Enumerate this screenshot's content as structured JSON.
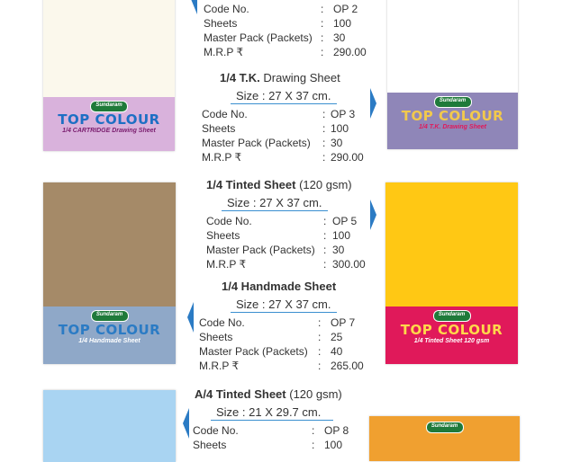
{
  "brand": "Sundaram",
  "logo_text": "TOP COLOUR",
  "products": [
    {
      "title_bold": "",
      "title_rest": "",
      "size": "",
      "specs": [
        {
          "label": "Code No.",
          "value": "OP 2"
        },
        {
          "label": "Sheets",
          "value": "100"
        },
        {
          "label": "Master Pack (Packets)",
          "value": "30"
        },
        {
          "label": "M.R.P ₹",
          "value": "290.00"
        }
      ],
      "pack_subtitle": "1/4 CARTRIDGE Drawing Sheet",
      "sheet_color": "#fbf8ec",
      "band_color": "#d9b2dc"
    },
    {
      "title_bold": "1/4 T.K.",
      "title_rest": " Drawing Sheet",
      "size": "Size : 27 X 37 cm.",
      "specs": [
        {
          "label": "Code No.",
          "value": "OP 3"
        },
        {
          "label": "Sheets",
          "value": "100"
        },
        {
          "label": "Master Pack (Packets)",
          "value": "30"
        },
        {
          "label": "M.R.P ₹",
          "value": "290.00"
        }
      ],
      "pack_subtitle": "1/4 T.K. Drawing Sheet",
      "sheet_color": "#ffffff",
      "band_color": "#8f86b8"
    },
    {
      "title_bold": "1/4 Tinted Sheet",
      "title_rest": " (120 gsm)",
      "size": "Size : 27 X 37 cm.",
      "specs": [
        {
          "label": "Code No.",
          "value": "OP 5"
        },
        {
          "label": "Sheets",
          "value": "100"
        },
        {
          "label": "Master Pack (Packets)",
          "value": "30"
        },
        {
          "label": "M.R.P ₹",
          "value": "300.00"
        }
      ],
      "pack_subtitle": "1/4 Tinted Sheet 120 gsm",
      "sheet_color": "#ffc814",
      "band_color": "#e0195a"
    },
    {
      "title_bold": "1/4 Handmade Sheet",
      "title_rest": "",
      "size": "Size : 27 X 37 cm.",
      "specs": [
        {
          "label": "Code No.",
          "value": "OP 7"
        },
        {
          "label": "Sheets",
          "value": "25"
        },
        {
          "label": "Master Pack (Packets)",
          "value": "40"
        },
        {
          "label": "M.R.P ₹",
          "value": "265.00"
        }
      ],
      "pack_subtitle": "1/4 Handmade Sheet",
      "sheet_color": "#a58a68",
      "band_color": "#8fa8c8"
    },
    {
      "title_bold": "A/4 Tinted Sheet",
      "title_rest": " (120 gsm)",
      "size": "Size : 21 X 29.7 cm.",
      "specs": [
        {
          "label": "Code No.",
          "value": "OP 8"
        },
        {
          "label": "Sheets",
          "value": "100"
        }
      ],
      "pack_subtitle": "",
      "sheet_color": "#a9d4f2",
      "band_color": "#f0a030"
    }
  ]
}
